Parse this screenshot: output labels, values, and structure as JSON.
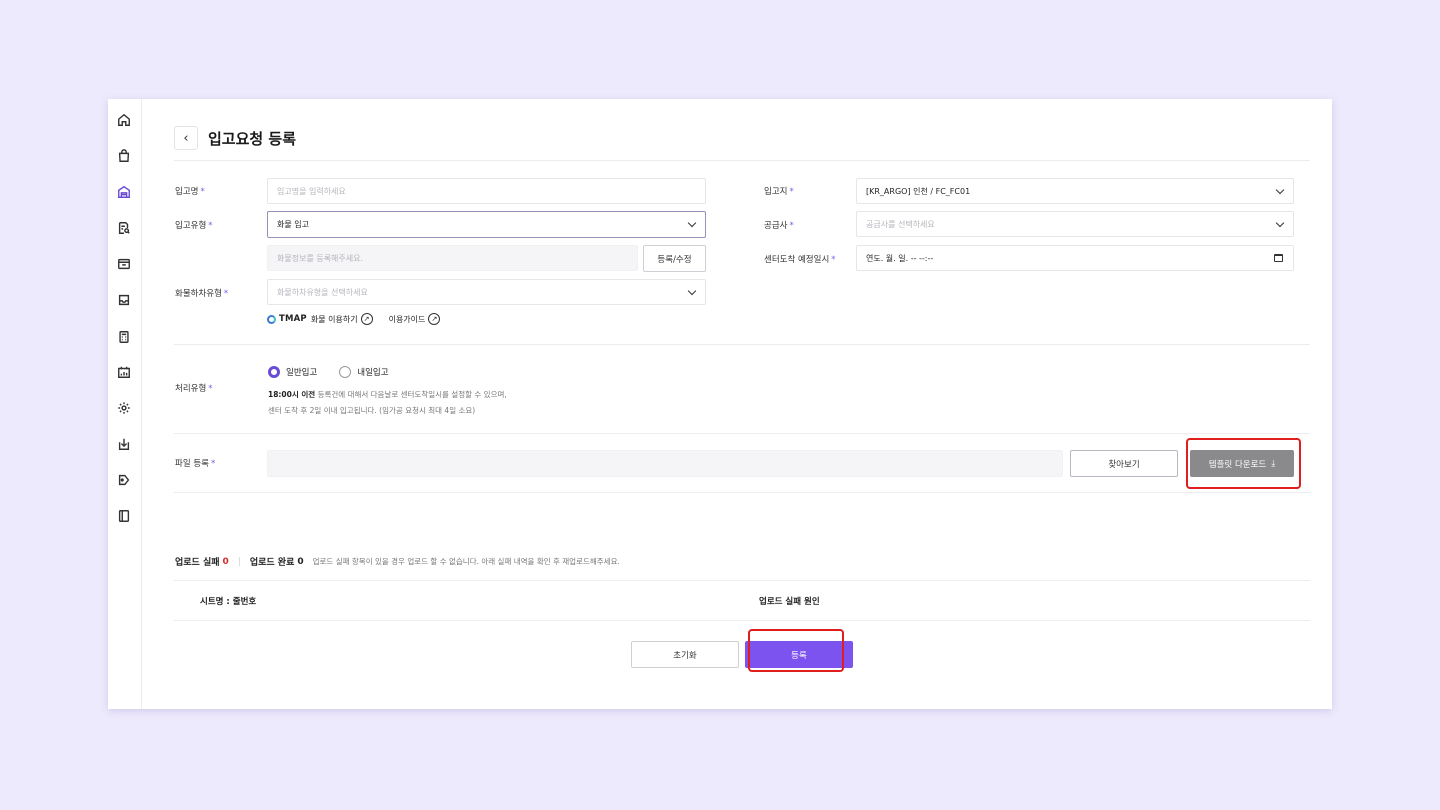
{
  "page": {
    "title": "입고요청 등록",
    "back_icon": "‹"
  },
  "sidebar": {
    "items": [
      {
        "icon": "home-icon"
      },
      {
        "icon": "bag-icon"
      },
      {
        "icon": "warehouse-icon"
      },
      {
        "icon": "document-search-icon"
      },
      {
        "icon": "box-icon"
      },
      {
        "icon": "inbox-icon"
      },
      {
        "icon": "calculator-icon"
      },
      {
        "icon": "calendar-chart-icon"
      },
      {
        "icon": "gear-icon"
      },
      {
        "icon": "download-icon"
      },
      {
        "icon": "tag-icon"
      },
      {
        "icon": "book-icon"
      }
    ]
  },
  "form": {
    "inbound_name": {
      "label": "입고명",
      "placeholder": "입고명을 입력하세요"
    },
    "inbound_type": {
      "label": "입고유형",
      "value": "화물 입고"
    },
    "cargo_info": {
      "placeholder": "화물정보를 등록해주세요.",
      "button": "등록/수정"
    },
    "unloading_type": {
      "label": "화물하차유형",
      "placeholder": "화물하차유형을 선택하세요"
    },
    "tmap": {
      "logo": "TMAP",
      "link1": "화물 이용하기",
      "link2": "이용가이드"
    },
    "warehouse": {
      "label": "입고지",
      "value": "[KR_ARGO] 인천 / FC_FC01"
    },
    "supplier": {
      "label": "공급사",
      "placeholder": "공급사를 선택하세요"
    },
    "arrival_datetime": {
      "label": "센터도착 예정일시",
      "value": "연도. 월. 일. -- --:--"
    },
    "processing_type": {
      "label": "처리유형",
      "option1": "일반입고",
      "option2": "내일입고",
      "note_bold": "18:00시 이전",
      "note_rest": " 등록건에 대해서 다음날로 센터도착일시를 설정할 수 있으며,",
      "note2": "센터 도착 후 2일 이내 입고됩니다. (임가공 요청시 최대 4일 소요)"
    },
    "file": {
      "label": "파일 등록",
      "browse": "찾아보기",
      "template_download": "템플릿 다운로드",
      "download_glyph": "⤓"
    },
    "required_mark": "*"
  },
  "upload": {
    "fail_label": "업로드 실패",
    "fail_count": "0",
    "success_label": "업로드 완료",
    "success_count": "0",
    "message": "업로드 실패 항목이 있을 경우 업로드 할 수 없습니다. 아래 실패 내역을 확인 후 재업로드해주세요.",
    "col_sheet": "시트명 : 줄번호",
    "col_reason": "업로드 실패 원인"
  },
  "actions": {
    "reset": "초기화",
    "submit": "등록"
  },
  "colors": {
    "accent": "#7d53f0",
    "highlight": "#e01e1e",
    "background": "#eeeafd"
  }
}
